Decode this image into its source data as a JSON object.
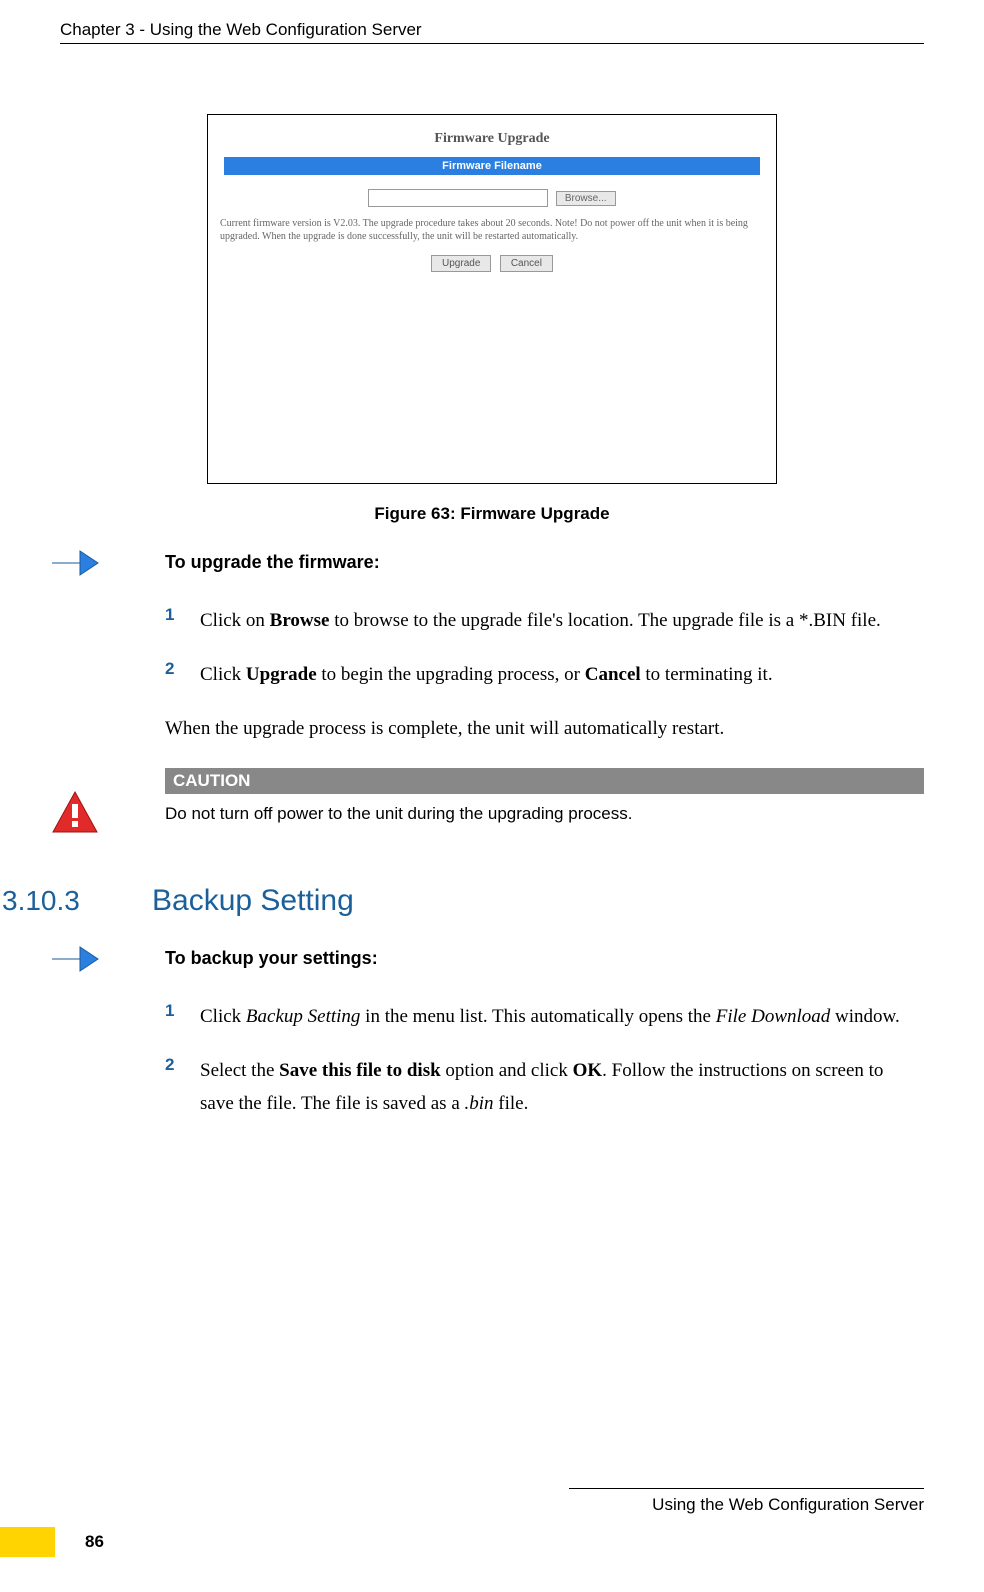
{
  "header": "Chapter 3 - Using the Web Configuration Server",
  "screenshot": {
    "title": "Firmware Upgrade",
    "bar_label": "Firmware Filename",
    "browse_btn": "Browse...",
    "note": "Current firmware version is V2.03. The upgrade procedure takes about 20 seconds. Note! Do not power off the unit when it is being upgraded. When the upgrade is done successfully, the unit will be restarted automatically.",
    "upgrade_btn": "Upgrade",
    "cancel_btn": "Cancel"
  },
  "figure_caption": "Figure 63: Firmware Upgrade",
  "upgrade_intro": "To upgrade the firmware:",
  "step1": {
    "num": "1",
    "pre": "Click on ",
    "bold": "Browse",
    "post": " to browse to the upgrade file's location. The upgrade file is a *.BIN file."
  },
  "step2": {
    "num": "2",
    "pre": "Click ",
    "bold1": "Upgrade",
    "mid": " to begin the upgrading process, or ",
    "bold2": "Cancel",
    "post": " to terminating it."
  },
  "upgrade_complete": "When the upgrade process is complete, the unit will automatically restart.",
  "caution": {
    "header": "CAUTION",
    "text": "Do not turn off power to the unit during the upgrading process."
  },
  "section": {
    "num": "3.10.3",
    "title": "Backup Setting"
  },
  "backup_intro": "To backup your settings:",
  "bstep1": {
    "num": "1",
    "pre": "Click ",
    "italic1": "Backup Setting",
    "mid": " in the menu list. This automatically opens the ",
    "italic2": "File Download",
    "post": " window."
  },
  "bstep2": {
    "num": "2",
    "pre": "Select the ",
    "bold1": "Save this file to disk",
    "mid": " option and click ",
    "bold2": "OK",
    "post1": ". Follow the instructions on screen to save the file. The file is saved as a ",
    "italic": ".bin",
    "post2": " file."
  },
  "footer_text": "Using the Web Configuration Server",
  "page_num": "86"
}
